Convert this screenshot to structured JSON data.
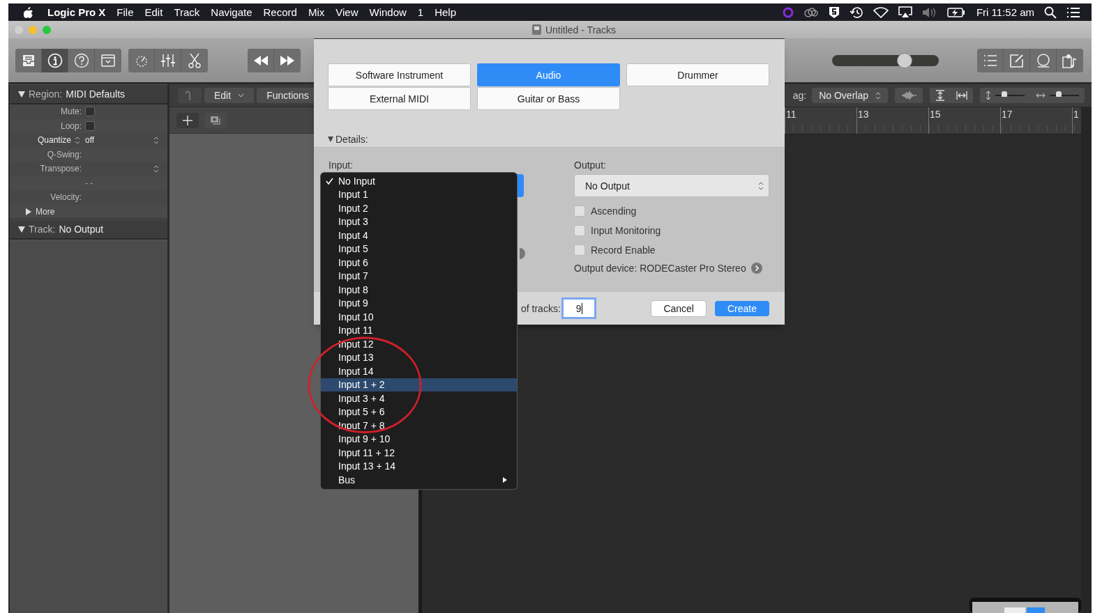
{
  "menu_bar": {
    "app": "Logic Pro X",
    "menus": [
      "File",
      "Edit",
      "Track",
      "Navigate",
      "Record",
      "Mix",
      "View",
      "Window",
      "1",
      "Help"
    ],
    "clock": "Fri 11:52 am"
  },
  "window": {
    "title": "Untitled - Tracks"
  },
  "toolbar": {
    "master_volume": {
      "level": 0.68
    }
  },
  "inspector": {
    "region_label": "Region:",
    "region_name": "MIDI Defaults",
    "rows": [
      {
        "kind": "checkbox",
        "label": "Mute:",
        "checked": false
      },
      {
        "kind": "checkbox",
        "label": "Loop:",
        "checked": false
      },
      {
        "kind": "select",
        "label": "Quantize",
        "value": "off"
      },
      {
        "kind": "plain",
        "label": "Q-Swing:"
      },
      {
        "kind": "stepper",
        "label": "Transpose:"
      },
      {
        "kind": "value",
        "value": "- -"
      },
      {
        "kind": "plain",
        "label": "Velocity:"
      }
    ],
    "more": "More",
    "track_label": "Track:",
    "track_name": "No Output"
  },
  "tracks_toolbar": {
    "edit": "Edit",
    "functions": "Functions",
    "drag_label": "ag:",
    "drag_value": "No Overlap",
    "vertical_zoom": {
      "level": 0.32
    },
    "horizontal_zoom": {
      "level": 0.3
    }
  },
  "ruler": [
    "11",
    "13",
    "15",
    "17",
    "1"
  ],
  "dialog": {
    "track_types": [
      {
        "label": "Software Instrument",
        "selected": false
      },
      {
        "label": "Audio",
        "selected": true
      },
      {
        "label": "Drummer",
        "selected": false
      },
      {
        "label": "External MIDI",
        "selected": false
      },
      {
        "label": "Guitar or Bass",
        "selected": false
      }
    ],
    "details": "Details:",
    "input_label": "Input:",
    "output_label": "Output:",
    "output_value": "No Output",
    "options": [
      {
        "label": "Ascending",
        "checked": false
      },
      {
        "label": "Input Monitoring",
        "checked": false
      },
      {
        "label": "Record Enable",
        "checked": false
      }
    ],
    "output_device": "Output device: RODECaster Pro Stereo",
    "tracks_label": "of tracks:",
    "tracks_value": "9",
    "buttons": [
      "Cancel",
      "Create"
    ]
  },
  "input_menu": {
    "items": [
      {
        "label": "No Input",
        "checked": true,
        "selected": false
      },
      {
        "label": "Input 1",
        "checked": false,
        "selected": false
      },
      {
        "label": "Input 2",
        "checked": false,
        "selected": false
      },
      {
        "label": "Input 3",
        "checked": false,
        "selected": false
      },
      {
        "label": "Input 4",
        "checked": false,
        "selected": false
      },
      {
        "label": "Input 5",
        "checked": false,
        "selected": false
      },
      {
        "label": "Input 6",
        "checked": false,
        "selected": false
      },
      {
        "label": "Input 7",
        "checked": false,
        "selected": false
      },
      {
        "label": "Input 8",
        "checked": false,
        "selected": false
      },
      {
        "label": "Input 9",
        "checked": false,
        "selected": false
      },
      {
        "label": "Input 10",
        "checked": false,
        "selected": false
      },
      {
        "label": "Input 11",
        "checked": false,
        "selected": false
      },
      {
        "label": "Input 12",
        "checked": false,
        "selected": false
      },
      {
        "label": "Input 13",
        "checked": false,
        "selected": false
      },
      {
        "label": "Input 14",
        "checked": false,
        "selected": false
      },
      {
        "label": "Input 1 + 2",
        "checked": false,
        "selected": true
      },
      {
        "label": "Input 3 + 4",
        "checked": false,
        "selected": false
      },
      {
        "label": "Input 5 + 6",
        "checked": false,
        "selected": false
      },
      {
        "label": "Input 7 + 8",
        "checked": false,
        "selected": false
      },
      {
        "label": "Input 9 + 10",
        "checked": false,
        "selected": false
      },
      {
        "label": "Input 11 + 12",
        "checked": false,
        "selected": false
      },
      {
        "label": "Input 13 + 14",
        "checked": false,
        "selected": false
      },
      {
        "label": "Bus",
        "checked": false,
        "selected": false,
        "submenu": true
      }
    ]
  }
}
